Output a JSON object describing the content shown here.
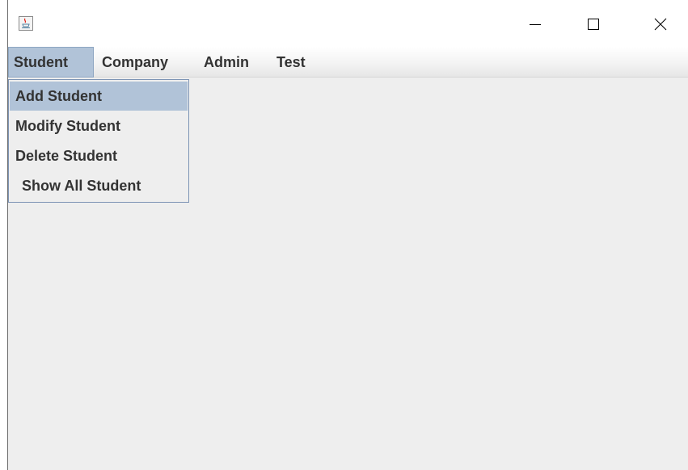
{
  "window": {
    "controls": {
      "minimize_icon": "minimize-icon",
      "maximize_icon": "maximize-icon",
      "close_icon": "close-icon"
    },
    "app_icon": "java-coffee-cup-icon"
  },
  "menubar": {
    "items": [
      {
        "label": "Student",
        "active": true
      },
      {
        "label": "Company",
        "active": false
      },
      {
        "label": "Admin",
        "active": false
      },
      {
        "label": "Test",
        "active": false
      }
    ]
  },
  "student_menu": {
    "items": [
      {
        "label": "Add Student",
        "selected": true
      },
      {
        "label": "Modify Student",
        "selected": false
      },
      {
        "label": "Delete Student",
        "selected": false
      },
      {
        "label": "Show All Student",
        "selected": false
      }
    ]
  },
  "colors": {
    "highlight": "#b1c3d8",
    "background": "#eeeeee",
    "popup_border": "#7d94b5",
    "text": "#333333"
  }
}
